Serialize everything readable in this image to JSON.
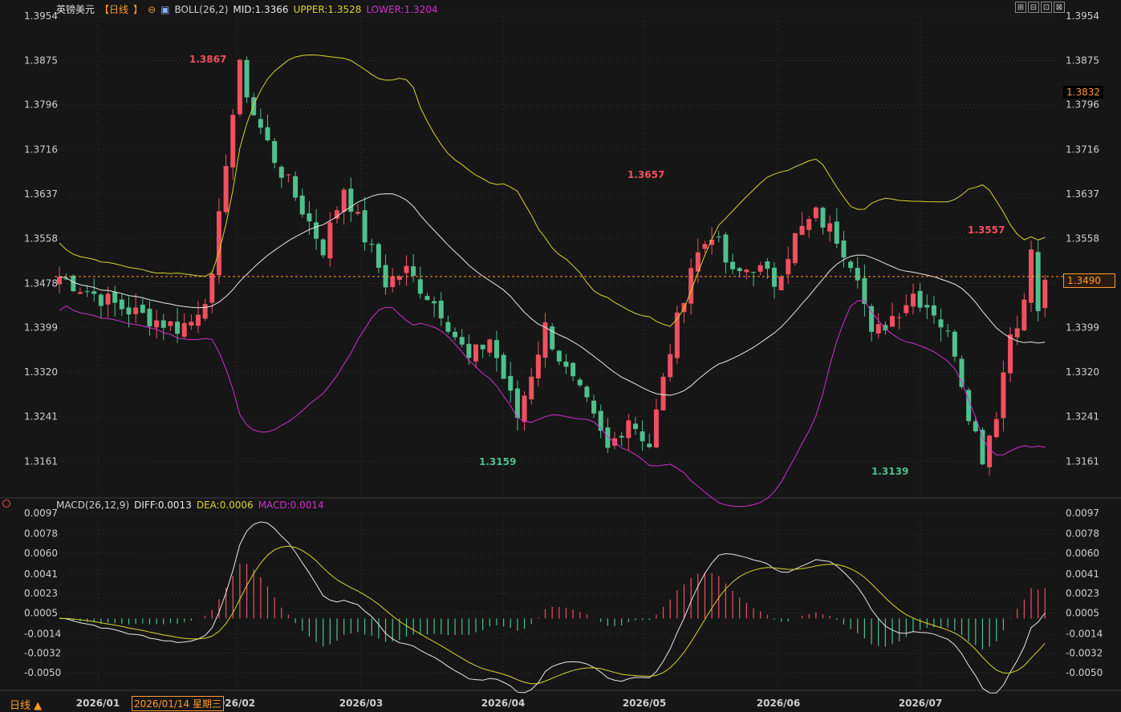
{
  "symbol": "英镑美元",
  "period": "日线",
  "period_dropdown": "日线 ▲",
  "boll": {
    "name": "BOLL(26,2)",
    "mid": "MID:1.3366",
    "upper": "UPPER:1.3528",
    "lower": "LOWER:1.3204"
  },
  "macd": {
    "name": "MACD(26,12,9)",
    "diff": "DIFF:0.0013",
    "dea": "DEA:0.0006",
    "macd": "MACD:0.0014"
  },
  "cursor_date": "2026/01/14 星期三",
  "last_price_label": "1.3490",
  "crosshair_price_label": "1.3832",
  "toolbar": [
    "⊞",
    "⊟",
    "⊡",
    "⊠"
  ],
  "colors": {
    "up": "#f0505f",
    "down": "#4fc08d",
    "upper": "#d8d430",
    "mid": "#e8e8e8",
    "lower": "#d030d0",
    "dea": "#d8d430",
    "diff": "#e8e8e8",
    "accent": "#ff9a2e"
  },
  "chart_data": [
    {
      "type": "candlestick",
      "title": "英镑美元 日线",
      "y_ticks": [
        "1.3954",
        "1.3875",
        "1.3796",
        "1.3716",
        "1.3637",
        "1.3558",
        "1.3478",
        "1.3399",
        "1.3320",
        "1.3241",
        "1.3161"
      ],
      "ylim": [
        1.31,
        1.3954
      ],
      "x_ticks": [
        "2026/01",
        "026/02",
        "2026/03",
        "2026/04",
        "2026/05",
        "2026/06",
        "2026/07"
      ],
      "annotations": [
        "1.3867",
        "1.3159",
        "1.3657",
        "1.3139",
        "1.3557"
      ],
      "last_price": 1.349,
      "grid": true
    },
    {
      "type": "line",
      "title": "MACD(26,12,9)",
      "y_ticks": [
        "0.0097",
        "0.0078",
        "0.0060",
        "0.0041",
        "0.0023",
        "0.0005",
        "-0.0014",
        "-0.0032",
        "-0.0050"
      ],
      "ylim": [
        -0.0064,
        0.0097
      ]
    }
  ]
}
